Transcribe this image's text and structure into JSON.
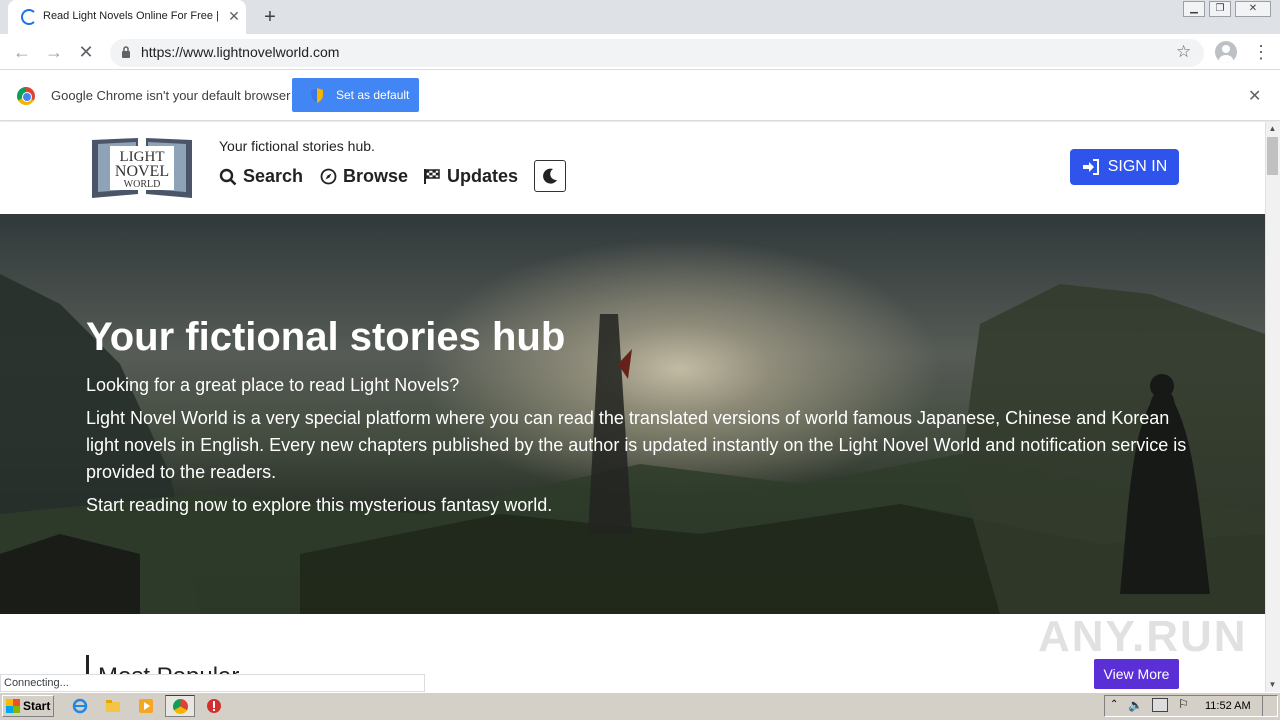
{
  "browser": {
    "tab_title": "Read Light Novels Online For Free | L",
    "url": "https://www.lightnovelworld.com",
    "infobar_text": "Google Chrome isn't your default browser",
    "set_default_label": "Set as default",
    "status_text": "Connecting..."
  },
  "site": {
    "logo": {
      "line1": "LIGHT",
      "line2": "NOVEL",
      "line3": "WORLD"
    },
    "tagline": "Your fictional stories hub.",
    "nav": [
      {
        "label": "Search",
        "icon": "search-icon"
      },
      {
        "label": "Browse",
        "icon": "compass-icon"
      },
      {
        "label": "Updates",
        "icon": "flag-icon"
      }
    ],
    "signin_label": "SIGN IN"
  },
  "hero": {
    "title": "Your fictional stories hub",
    "p1": "Looking for a great place to read Light Novels?",
    "p2": "Light Novel World is a very special platform where you can read the translated versions of world famous Japanese, Chinese and Korean light novels in English. Every new chapters published by the author is updated instantly on the Light Novel World and notification service is provided to the readers.",
    "p3": "Start reading now to explore this mysterious fantasy world."
  },
  "section": {
    "title": "Most Popular",
    "view_more": "View More"
  },
  "watermark": "ANY.RUN",
  "taskbar": {
    "start_label": "Start",
    "clock": "11:52 AM"
  }
}
